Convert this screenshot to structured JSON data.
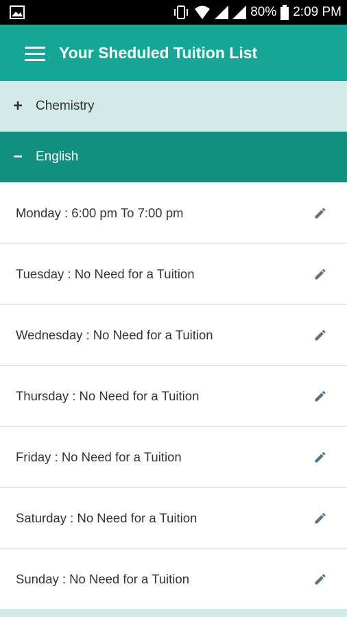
{
  "status_bar": {
    "battery": "80%",
    "time": "2:09 PM",
    "icons": [
      "image-icon",
      "vibrate-icon",
      "wifi-icon",
      "signal-icon",
      "signal-icon",
      "battery-icon"
    ]
  },
  "app_bar": {
    "title": "Your Sheduled Tuition List",
    "menu_icon": "hamburger-menu-icon",
    "color": "#14a797"
  },
  "groups": [
    {
      "label": "Chemistry",
      "sign": "+",
      "expanded": false
    },
    {
      "label": "English",
      "sign": "−",
      "expanded": true
    }
  ],
  "schedule": [
    {
      "text": "Monday : 6:00 pm To 7:00 pm",
      "icon": "edit-pencil-icon"
    },
    {
      "text": "Tuesday : No Need for a Tuition",
      "icon": "edit-pencil-icon"
    },
    {
      "text": "Wednesday : No Need for a Tuition",
      "icon": "edit-pencil-icon"
    },
    {
      "text": "Thursday : No Need for a Tuition",
      "icon": "edit-pencil-icon"
    },
    {
      "text": "Friday : No Need for a Tuition",
      "icon": "edit-pencil-icon"
    },
    {
      "text": "Saturday : No Need for a Tuition",
      "icon": "edit-pencil-icon"
    },
    {
      "text": "Sunday : No Need for a Tuition",
      "icon": "edit-pencil-icon"
    }
  ],
  "colors": {
    "accent": "#14a797",
    "expanded_header": "#11907f",
    "collapsed_header": "#d3ebe8",
    "edit_icon": "#5b7384"
  }
}
